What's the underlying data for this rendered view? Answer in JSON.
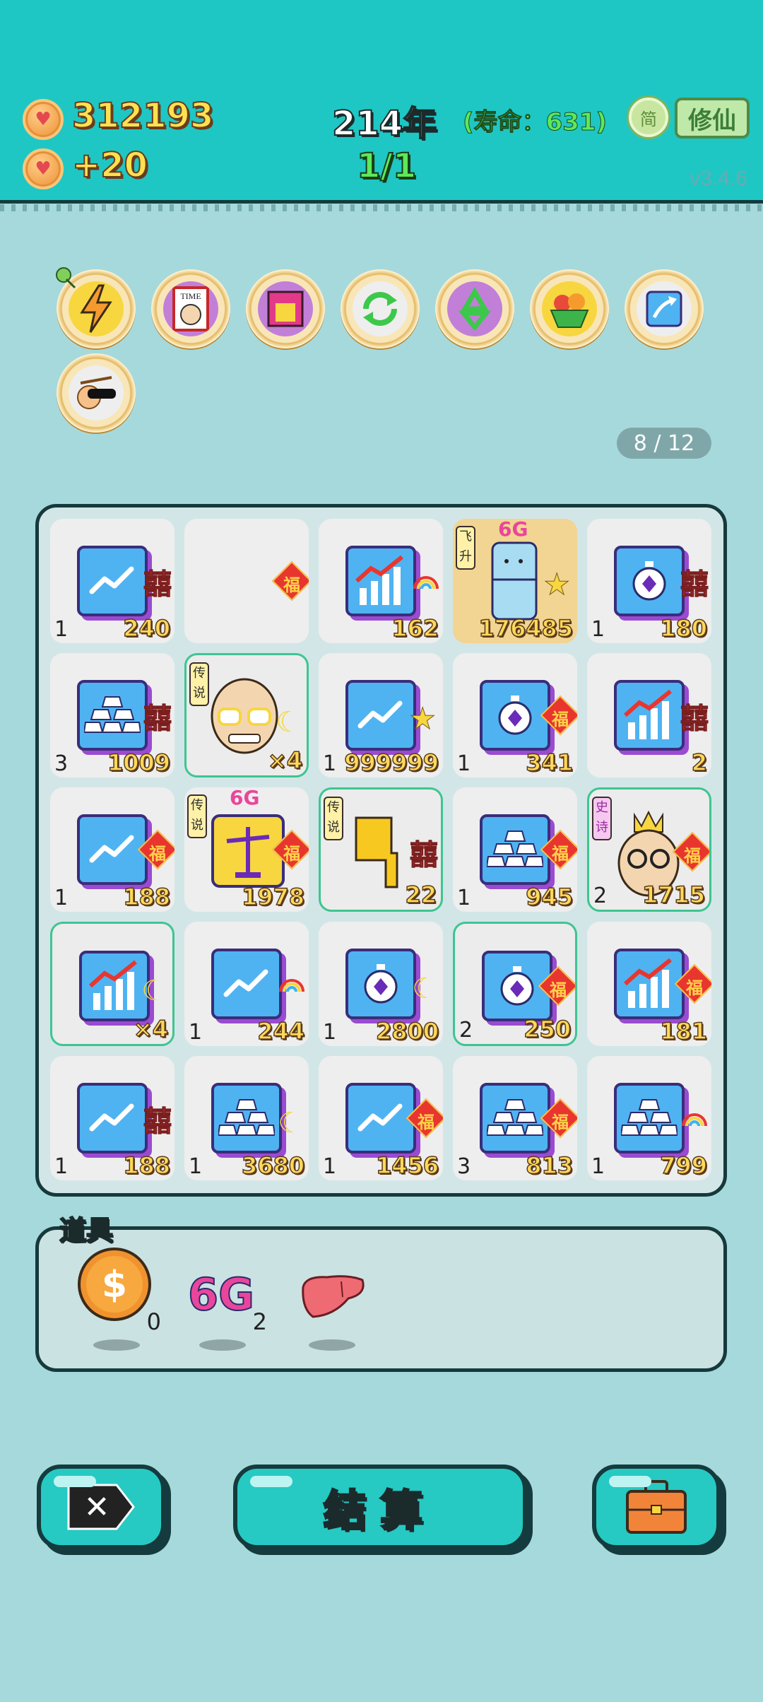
{
  "header": {
    "coins": "312193",
    "coin_gain": "+20",
    "year": "214年",
    "lifespan": "(寿命：631)",
    "round": "1/1",
    "simple_label": "简",
    "xiuxian_label": "修仙",
    "version": "v3.4.6"
  },
  "relics": [
    {
      "name": "lightning"
    },
    {
      "name": "time-magazine"
    },
    {
      "name": "fortune-box"
    },
    {
      "name": "cycle"
    },
    {
      "name": "recycle"
    },
    {
      "name": "fruit-basket"
    },
    {
      "name": "arrow-up"
    },
    {
      "name": "peach-sunglasses"
    }
  ],
  "page_indicator": "8 / 12",
  "board": {
    "rows": [
      [
        {
          "icon": "trend-up-icon",
          "tag": "囍",
          "left": "1",
          "right": "240"
        },
        {
          "icon": "",
          "tag": "福",
          "left": "",
          "right": ""
        },
        {
          "icon": "bar-chart-icon",
          "tag": "rainbow",
          "left": "",
          "right": "162"
        },
        {
          "icon": "fridge-icon",
          "tag": "star",
          "left": "",
          "right": "176485",
          "label": "飞升",
          "six_g": "6G"
        },
        {
          "icon": "timer-icon",
          "tag": "囍",
          "left": "1",
          "right": "180"
        }
      ],
      [
        {
          "icon": "gold-ingots-icon",
          "tag": "囍",
          "left": "3",
          "right": "1009"
        },
        {
          "icon": "old-man-face-icon",
          "tag": "moon",
          "left": "",
          "right": "×4",
          "label": "传说"
        },
        {
          "icon": "trend-up-icon",
          "tag": "star",
          "left": "1",
          "right": "999999"
        },
        {
          "icon": "timer-icon",
          "tag": "福",
          "left": "1",
          "right": "341"
        },
        {
          "icon": "bar-chart-icon",
          "tag": "囍",
          "left": "",
          "right": "2"
        }
      ],
      [
        {
          "icon": "trend-up-icon",
          "tag": "福",
          "left": "1",
          "right": "188"
        },
        {
          "icon": "scales-icon",
          "tag": "福",
          "left": "",
          "right": "1978",
          "label": "传说",
          "six_g": "6G"
        },
        {
          "icon": "pointing-hand-icon",
          "tag": "囍",
          "left": "",
          "right": "22",
          "label": "传说"
        },
        {
          "icon": "gold-ingots-icon",
          "tag": "福",
          "left": "1",
          "right": "945"
        },
        {
          "icon": "king-face-icon",
          "tag": "福",
          "left": "2",
          "right": "1715",
          "label": "史诗"
        }
      ],
      [
        {
          "icon": "bar-chart-icon",
          "tag": "moon",
          "left": "",
          "right": "×4"
        },
        {
          "icon": "trend-up-icon",
          "tag": "rainbow",
          "left": "1",
          "right": "244"
        },
        {
          "icon": "timer-icon",
          "tag": "moon",
          "left": "1",
          "right": "2800"
        },
        {
          "icon": "timer-icon",
          "tag": "福",
          "left": "2",
          "right": "250"
        },
        {
          "icon": "bar-chart-icon",
          "tag": "福",
          "left": "",
          "right": "181"
        }
      ],
      [
        {
          "icon": "trend-up-icon",
          "tag": "囍",
          "left": "1",
          "right": "188"
        },
        {
          "icon": "gold-ingots-icon",
          "tag": "moon",
          "left": "1",
          "right": "3680"
        },
        {
          "icon": "trend-up-icon",
          "tag": "福",
          "left": "1",
          "right": "1456"
        },
        {
          "icon": "gold-ingots-icon",
          "tag": "福",
          "left": "3",
          "right": "813"
        },
        {
          "icon": "gold-ingots-icon",
          "tag": "rainbow",
          "left": "1",
          "right": "799"
        }
      ]
    ]
  },
  "props": {
    "title": "道具",
    "items": [
      {
        "name": "coin",
        "glyph": "$",
        "count": "0"
      },
      {
        "name": "6g",
        "glyph": "6G",
        "count": "2"
      },
      {
        "name": "liver",
        "glyph": "",
        "count": ""
      }
    ]
  },
  "buttons": {
    "close_icon": "✕",
    "settle_label": "结算",
    "bag_icon": "briefcase"
  },
  "colors": {
    "header_bg": "#1ec7c4",
    "page_bg": "#a6d9dc",
    "button_bg": "#27c9c3",
    "number_yellow": "#ffd95a"
  }
}
